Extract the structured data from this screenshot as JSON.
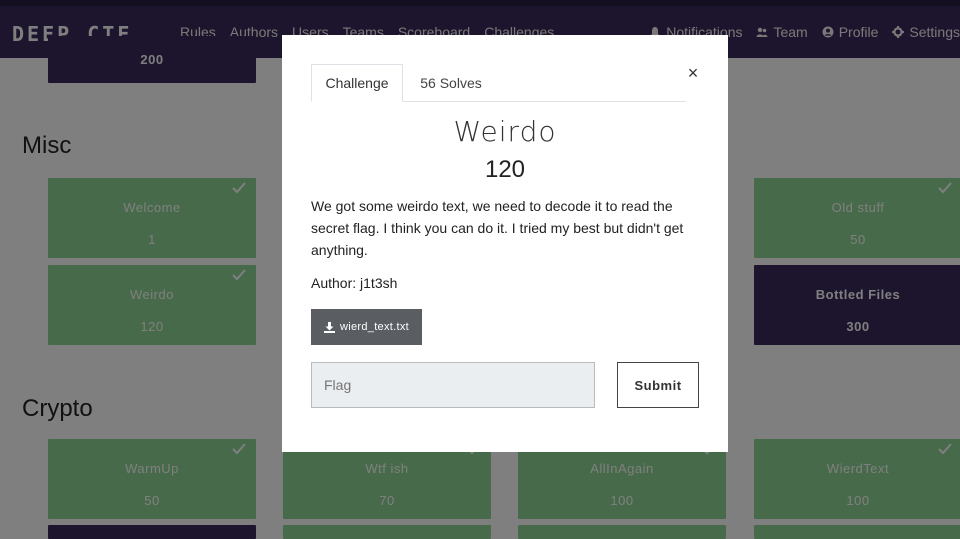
{
  "navbar": {
    "brand": "DEEP CTF",
    "left_links": [
      "Rules",
      "Authors",
      "Users",
      "Teams",
      "Scoreboard",
      "Challenges"
    ],
    "right_links": [
      {
        "label": "Notifications",
        "icon": "bell-icon"
      },
      {
        "label": "Team",
        "icon": "users-icon"
      },
      {
        "label": "Profile",
        "icon": "user-circle-icon"
      },
      {
        "label": "Settings",
        "icon": "gear-icon"
      }
    ]
  },
  "board": {
    "top_partial_value": "200",
    "sections": [
      {
        "title": "Misc"
      },
      {
        "title": "Crypto"
      }
    ],
    "misc_cards": [
      {
        "name": "Welcome",
        "value": "1",
        "solved": true
      },
      {
        "name": "Old stuff",
        "value": "50",
        "solved": true
      },
      {
        "name": "Weirdo",
        "value": "120",
        "solved": true
      },
      {
        "name": "Bottled Files",
        "value": "300",
        "solved": false
      }
    ],
    "crypto_cards": [
      {
        "name": "WarmUp",
        "value": "50",
        "solved": true
      },
      {
        "name": "Wtf ish",
        "value": "70",
        "solved": true
      },
      {
        "name": "AllInAgain",
        "value": "100",
        "solved": true
      },
      {
        "name": "WierdText",
        "value": "100",
        "solved": true
      }
    ]
  },
  "modal": {
    "tabs": {
      "challenge": "Challenge",
      "solves": "56 Solves"
    },
    "close_symbol": "×",
    "title": "Weirdo",
    "value": "120",
    "description": "We got some weirdo text, we need to decode it to read the secret flag. I think you can do it. I tried my best but didn't get anything.",
    "author": "Author: j1t3sh",
    "file": {
      "name": "wierd_text.txt",
      "icon": "download-icon"
    },
    "flag_input": {
      "placeholder": "Flag",
      "value": ""
    },
    "submit_label": "Submit"
  },
  "colors": {
    "navbar": "#3b2a5a",
    "solved_card": "#8fd694",
    "unsolved_card": "#3b2a5a",
    "file_button": "#5a5e62",
    "overlay": "rgba(0,0,0,0.5)"
  }
}
